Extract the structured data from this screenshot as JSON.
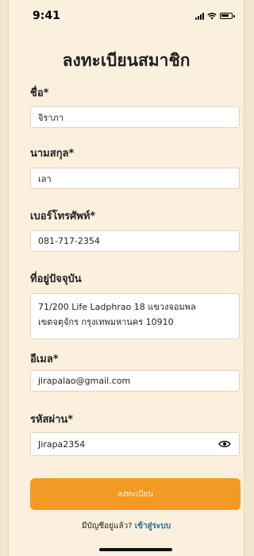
{
  "status": {
    "time": "9:41"
  },
  "title": "ลงทะเบียนสมาชิก",
  "fields": {
    "first_name": {
      "label": "ชื่อ*",
      "value": "จิราภา"
    },
    "last_name": {
      "label": "นามสกุล*",
      "value": "เลา"
    },
    "phone": {
      "label": "เบอร์โทรศัพท์*",
      "value": "081-717-2354"
    },
    "address": {
      "label": "ที่อยู่ปัจจุบัน",
      "value": "71/200 Life Ladphrao 18 แขวงจอมพล\nเขตจตุจักร กรุงเทพมหานคร 10910"
    },
    "email": {
      "label": "อีเมล*",
      "value": "jirapalao@gmail.com"
    },
    "password": {
      "label": "รหัสผ่าน*",
      "value": "Jirapa2354"
    }
  },
  "register_button": "ลงทะเบียน",
  "login_prompt": {
    "text": "มีบัญชีอยู่แล้ว?",
    "link": "เข้าสู่ระบบ"
  },
  "icons": {
    "password_toggle": "eye-icon",
    "battery": "battery-icon",
    "wifi": "wifi-icon",
    "signal": "signal-icon"
  },
  "colors": {
    "background": "#fbf0de",
    "accent": "#f39a24",
    "link": "#1f6d93"
  }
}
